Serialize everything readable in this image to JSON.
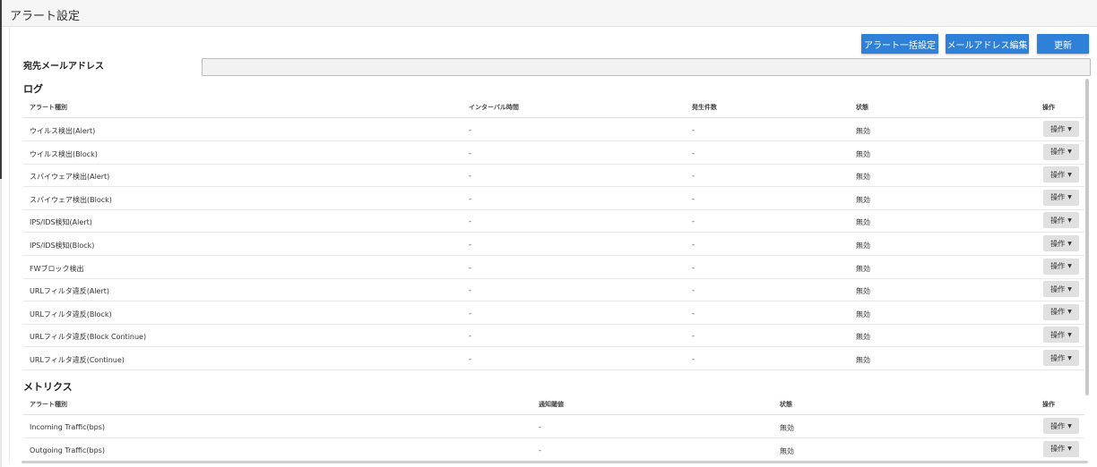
{
  "page": {
    "title": "アラート設定"
  },
  "toolbar": {
    "bulk_label": "アラート一括設定",
    "email_edit_label": "メールアドレス編集",
    "update_label": "更新"
  },
  "email": {
    "label": "宛先メールアドレス",
    "value": ""
  },
  "log": {
    "title": "ログ",
    "headers": {
      "type": "アラート種別",
      "interval": "インターバル時間",
      "count": "発生件数",
      "status": "状態",
      "op": "操作"
    },
    "rows": [
      {
        "type": "ウイルス検出(Alert)",
        "interval": "-",
        "count": "-",
        "status": "無効",
        "op": "操作"
      },
      {
        "type": "ウイルス検出(Block)",
        "interval": "-",
        "count": "-",
        "status": "無効",
        "op": "操作"
      },
      {
        "type": "スパイウェア検出(Alert)",
        "interval": "-",
        "count": "-",
        "status": "無効",
        "op": "操作"
      },
      {
        "type": "スパイウェア検出(Block)",
        "interval": "-",
        "count": "-",
        "status": "無効",
        "op": "操作"
      },
      {
        "type": "IPS/IDS検知(Alert)",
        "interval": "-",
        "count": "-",
        "status": "無効",
        "op": "操作"
      },
      {
        "type": "IPS/IDS検知(Block)",
        "interval": "-",
        "count": "-",
        "status": "無効",
        "op": "操作"
      },
      {
        "type": "FWブロック検出",
        "interval": "-",
        "count": "-",
        "status": "無効",
        "op": "操作"
      },
      {
        "type": "URLフィルタ違反(Alert)",
        "interval": "-",
        "count": "-",
        "status": "無効",
        "op": "操作"
      },
      {
        "type": "URLフィルタ違反(Block)",
        "interval": "-",
        "count": "-",
        "status": "無効",
        "op": "操作"
      },
      {
        "type": "URLフィルタ違反(Block Continue)",
        "interval": "-",
        "count": "-",
        "status": "無効",
        "op": "操作"
      },
      {
        "type": "URLフィルタ違反(Continue)",
        "interval": "-",
        "count": "-",
        "status": "無効",
        "op": "操作"
      }
    ]
  },
  "metrics": {
    "title": "メトリクス",
    "headers": {
      "type": "アラート種別",
      "threshold": "通知閾値",
      "status": "状態",
      "op": "操作"
    },
    "rows": [
      {
        "type": "Incoming Traffic(bps)",
        "threshold": "-",
        "status": "無効",
        "op": "操作"
      },
      {
        "type": "Outgoing Traffic(bps)",
        "threshold": "-",
        "status": "無効",
        "op": "操作"
      }
    ]
  },
  "icons": {
    "caret": "caret-down-icon"
  },
  "colors": {
    "primary": "#2f80d8",
    "op_button": "#e0e0e0",
    "header_bg": "#f5f5f5"
  }
}
